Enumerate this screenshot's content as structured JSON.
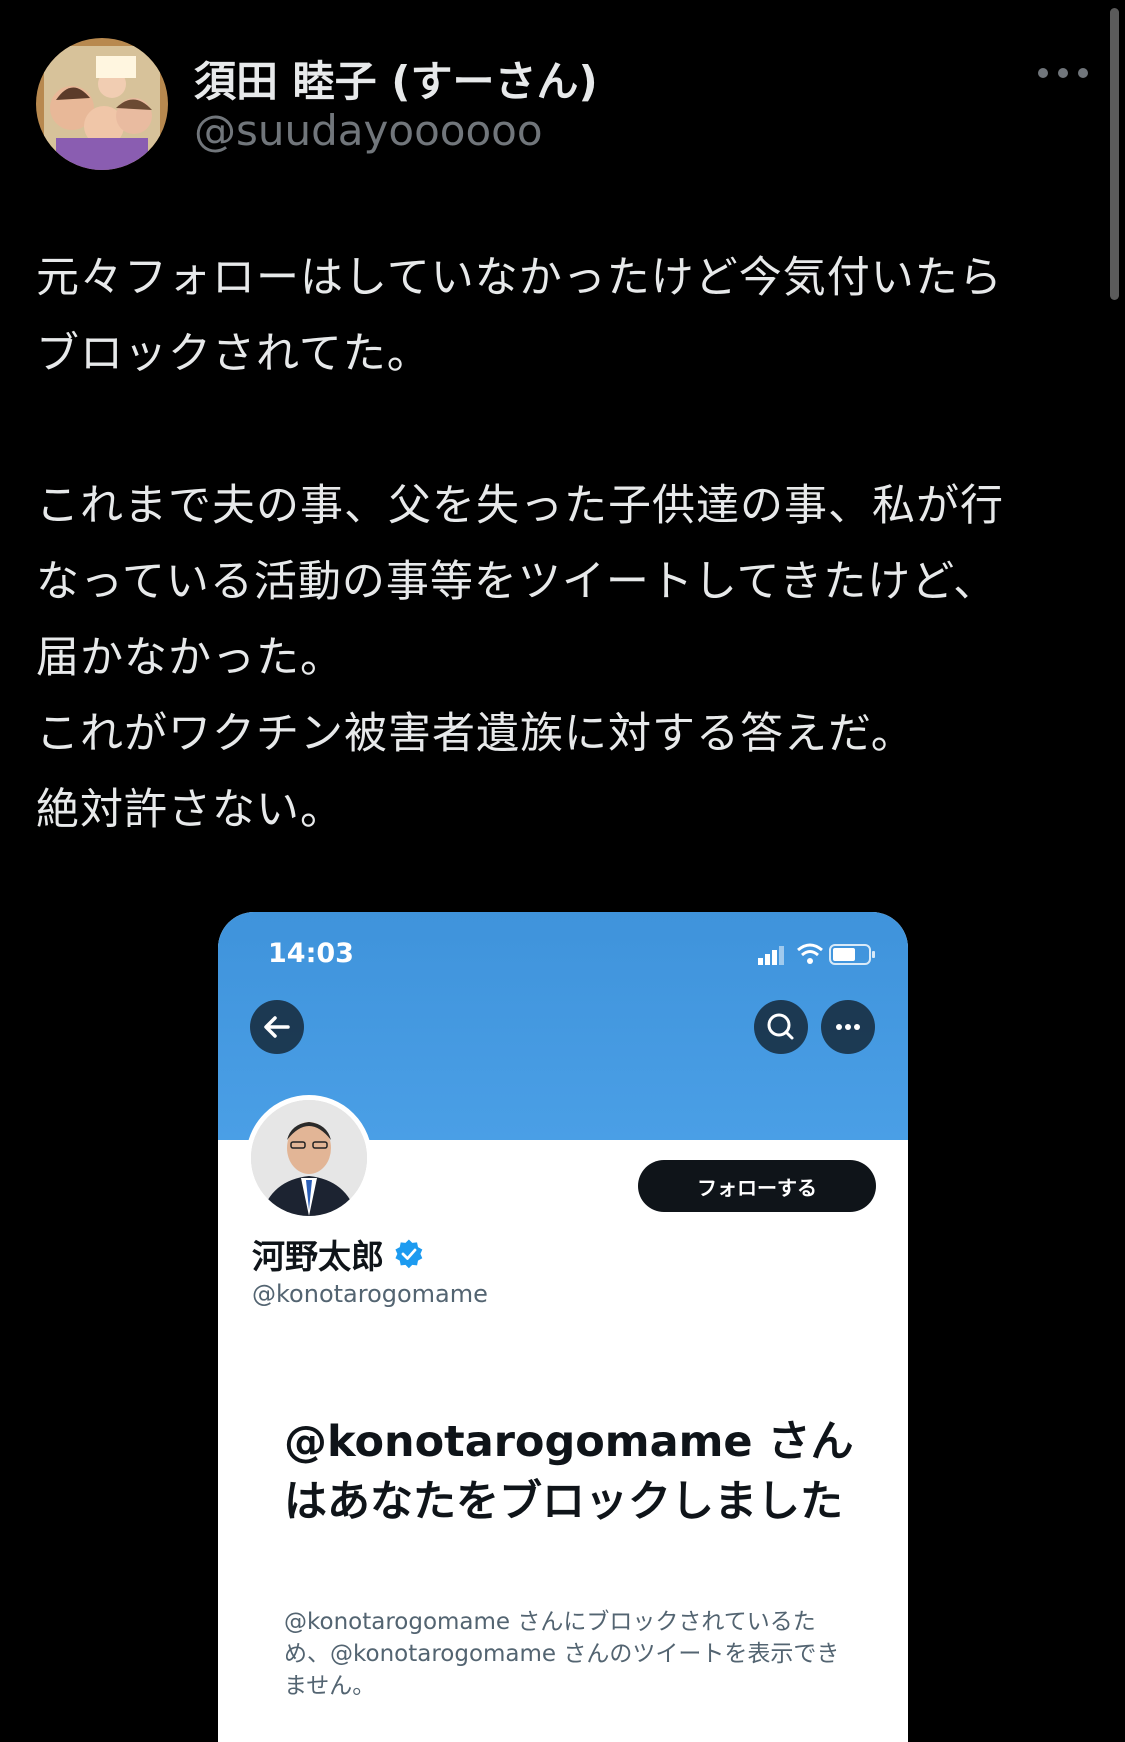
{
  "tweet": {
    "author": {
      "display_name": "須田 睦子 (すーさん)",
      "handle": "@suudayoooooo"
    },
    "text_lines": [
      "元々フォローはしていなかったけど今気付いたら",
      "ブロックされてた。",
      "",
      "これまで夫の事、父を失った子供達の事、私が行",
      "なっている活動の事等をツイートしてきたけど、",
      "届かなかった。",
      "これがワクチン被害者遺族に対する答えだ。",
      "絶対許さない。"
    ]
  },
  "embedded_screenshot": {
    "status_bar": {
      "time": "14:03"
    },
    "profile": {
      "name": "河野太郎",
      "handle": "@konotarogomame",
      "follow_label": "フォローする"
    },
    "blocked_notice": {
      "title": "@konotarogomame さんはあなたをブロックしました",
      "description": "@konotarogomame さんにブロックされているため、@konotarogomame さんのツイートを表示できません。"
    },
    "colors": {
      "banner": "#4a9fe6",
      "verified": "#1d9bf0"
    }
  },
  "icons": {
    "more": "more-horizontal-icon",
    "back": "arrow-left-icon",
    "search": "search-icon",
    "verified": "verified-badge-icon"
  }
}
